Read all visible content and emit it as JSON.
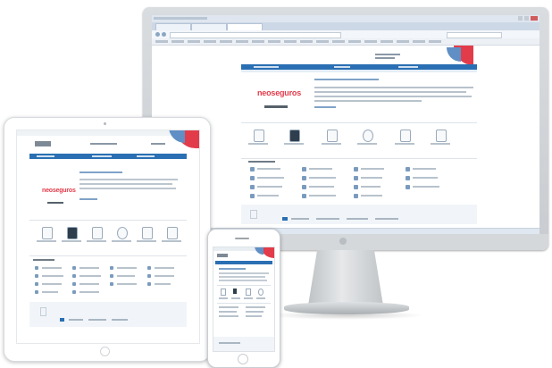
{
  "scene": {
    "description_devices": [
      "monitor",
      "tablet",
      "phone"
    ]
  },
  "monitor": {
    "logo": "neoseguros",
    "heading": "",
    "services_count": 6,
    "list_rows": 4
  },
  "tablet": {
    "logo": "neoseguros"
  },
  "colors": {
    "nav_blue": "#2a6fb3",
    "brand_red": "#e23c4a",
    "page_bg": "#ffffff"
  }
}
